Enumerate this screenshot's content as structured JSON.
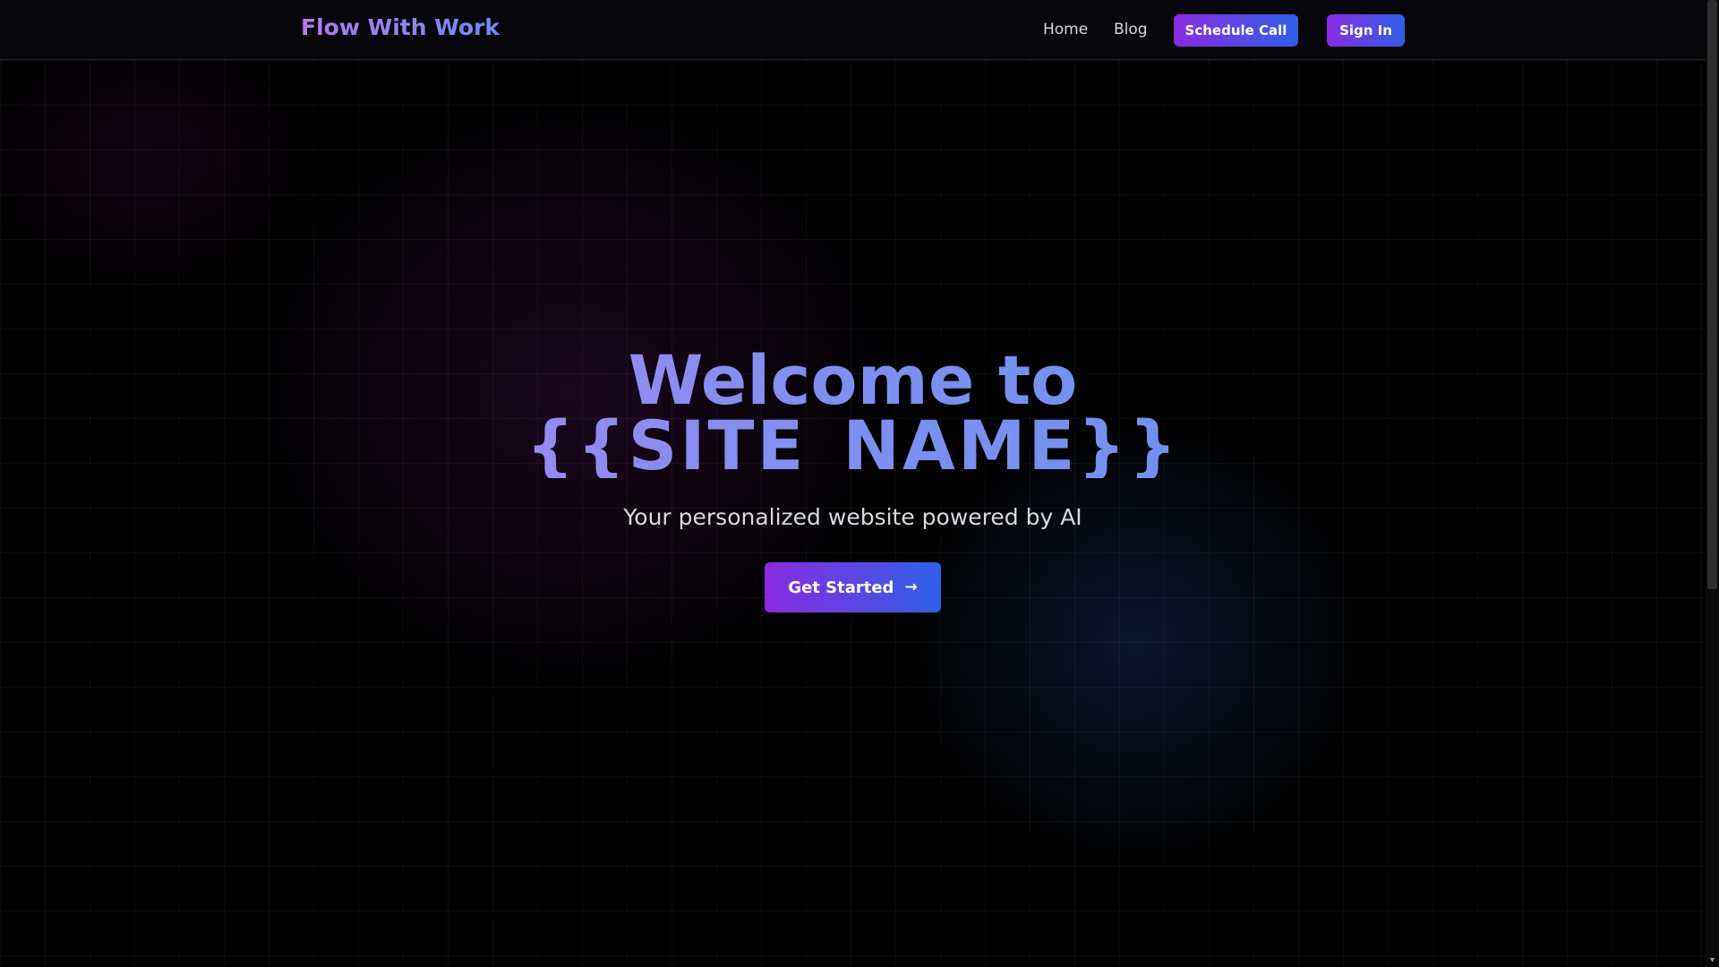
{
  "navbar": {
    "brand": "Flow With Work",
    "links": [
      {
        "label": "Home"
      },
      {
        "label": "Blog"
      }
    ],
    "schedule_button": "Schedule Call",
    "signin_button": "Sign In"
  },
  "hero": {
    "title_line1": "Welcome to",
    "title_line2": "{{SITE_NAME}}",
    "subtitle": "Your personalized website powered by AI",
    "cta_label": "Get Started",
    "cta_icon": "→"
  },
  "colors": {
    "accent_purple": "#8a2be2",
    "accent_blue": "#2f5fe6",
    "background": "#000000"
  },
  "scrollbar": {
    "down_arrow": "▾"
  }
}
